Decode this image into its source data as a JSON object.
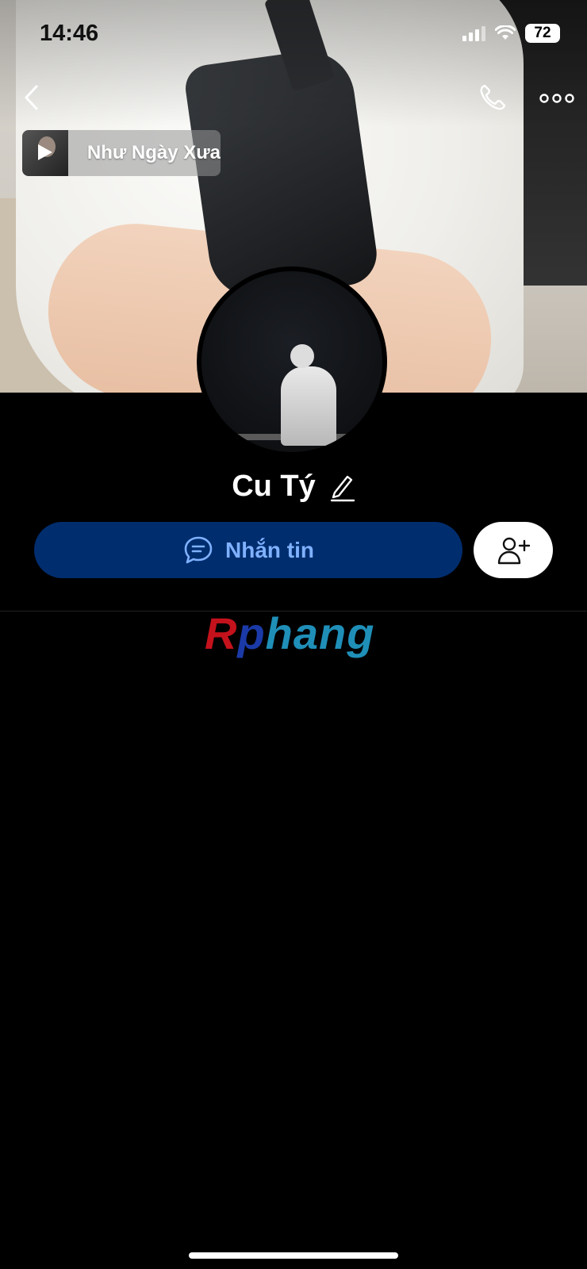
{
  "status_bar": {
    "time": "14:46",
    "battery": "72"
  },
  "top_bar": {
    "back_icon": "chevron-left-icon",
    "call_icon": "phone-icon",
    "more_icon": "more-horizontal-icon"
  },
  "music": {
    "title": "Như Ngày Xưa",
    "play_icon": "play-icon"
  },
  "profile": {
    "name": "Cu Tý",
    "edit_icon": "pencil-icon"
  },
  "actions": {
    "message_label": "Nhắn tin",
    "message_icon": "chat-bubble-icon",
    "add_friend_icon": "add-user-icon"
  },
  "watermark": {
    "part_r": "R",
    "part_p": "p",
    "part_rest": "hang"
  },
  "colors": {
    "background": "#000000",
    "message_button": "#002d6e",
    "message_text": "#7fb1ff",
    "add_button": "#ffffff"
  }
}
